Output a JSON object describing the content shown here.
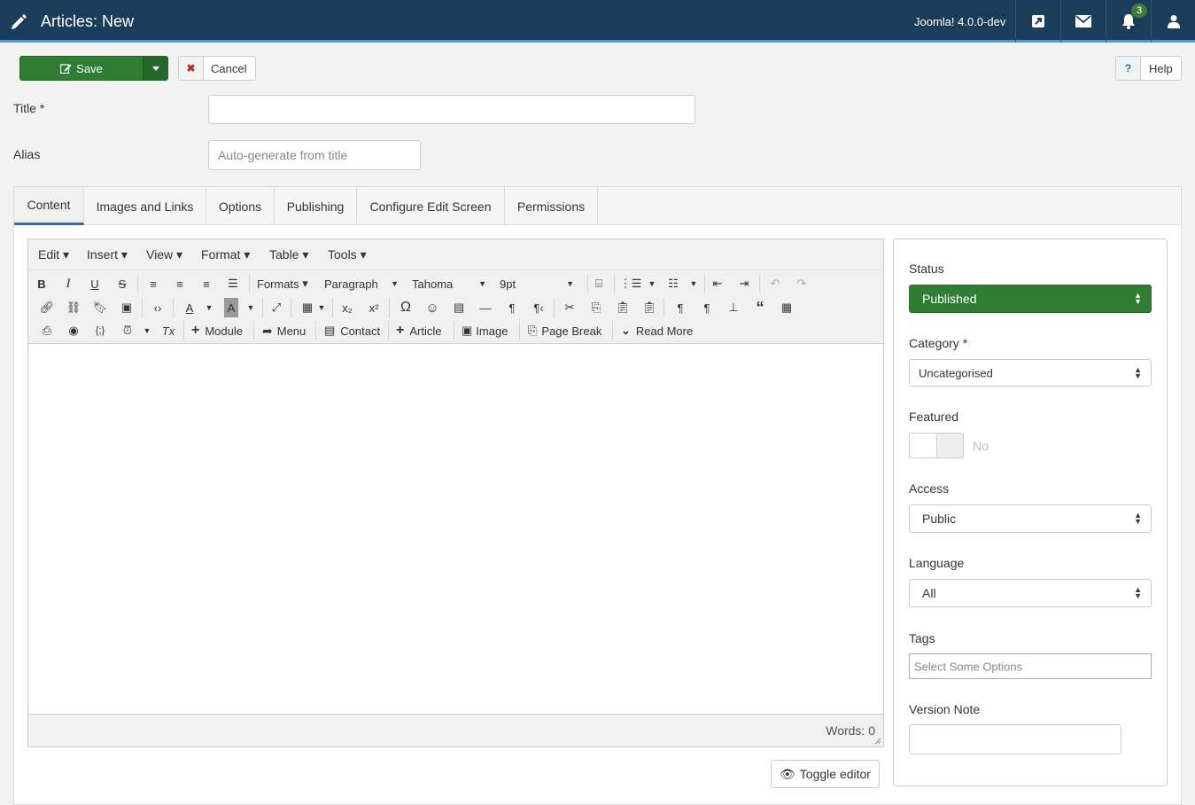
{
  "header": {
    "title": "Articles: New",
    "version": "Joomla! 4.0.0-dev",
    "notification_count": "3",
    "icons": [
      "pencil-icon",
      "external-link-icon",
      "envelope-icon",
      "bell-icon",
      "user-icon"
    ]
  },
  "toolbar": {
    "save_label": "Save",
    "cancel_label": "Cancel",
    "help_label": "Help",
    "help_icon": "?"
  },
  "form": {
    "title_label": "Title *",
    "title_value": "",
    "alias_label": "Alias",
    "alias_placeholder": "Auto-generate from title"
  },
  "tabs": [
    {
      "label": "Content",
      "active": true
    },
    {
      "label": "Images and Links"
    },
    {
      "label": "Options"
    },
    {
      "label": "Publishing"
    },
    {
      "label": "Configure Edit Screen"
    },
    {
      "label": "Permissions"
    }
  ],
  "editor": {
    "menu": [
      "Edit",
      "Insert",
      "View",
      "Format",
      "Table",
      "Tools"
    ],
    "formats_label": "Formats",
    "block_format": "Paragraph",
    "font_family": "Tahoma",
    "font_size": "9pt",
    "buttons": {
      "module": "Module",
      "menu": "Menu",
      "contact": "Contact",
      "article": "Article",
      "image": "Image",
      "page_break": "Page Break",
      "read_more": "Read More"
    },
    "word_count": "Words: 0",
    "toggle_label": "Toggle editor"
  },
  "sidebar": {
    "status_label": "Status",
    "status_value": "Published",
    "category_label": "Category *",
    "category_value": "Uncategorised",
    "featured_label": "Featured",
    "featured_value": "No",
    "access_label": "Access",
    "access_value": "Public",
    "language_label": "Language",
    "language_value": "All",
    "tags_label": "Tags",
    "tags_placeholder": "Select Some Options",
    "version_note_label": "Version Note"
  },
  "colors": {
    "header_bg": "#1c3d5a",
    "accent": "#3ea0e3",
    "success": "#2f7d32"
  }
}
